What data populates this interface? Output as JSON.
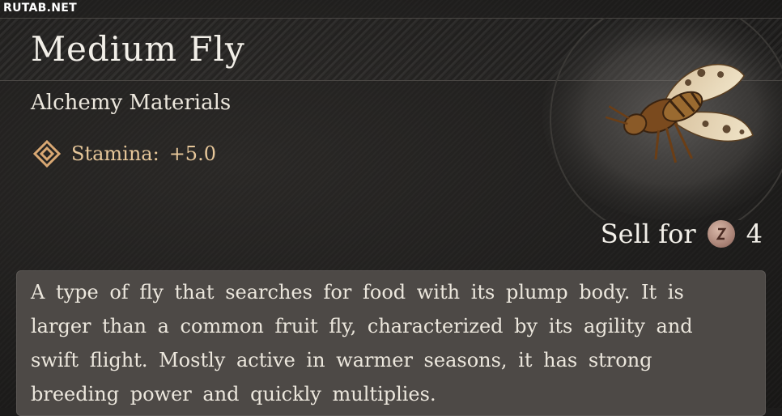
{
  "watermark": "RUTAB.NET",
  "item": {
    "name": "Medium Fly",
    "category": "Alchemy Materials",
    "stat": {
      "label": "Stamina:",
      "value": "+5.0",
      "icon": "diamond-stamina-icon"
    },
    "sell": {
      "label": "Sell for",
      "amount": "4",
      "icon": "coin-icon"
    },
    "description": "A type of fly that searches for food with its plump body. It is larger than a common fruit fly, characterized by its agility and swift flight. Mostly active in warmer seasons, it has strong breeding power and quickly multiplies."
  },
  "colors": {
    "background": "#1d1c1b",
    "stat_text": "#e7c79a",
    "description_box": "#4d4946",
    "title_text": "#f2efe8"
  }
}
